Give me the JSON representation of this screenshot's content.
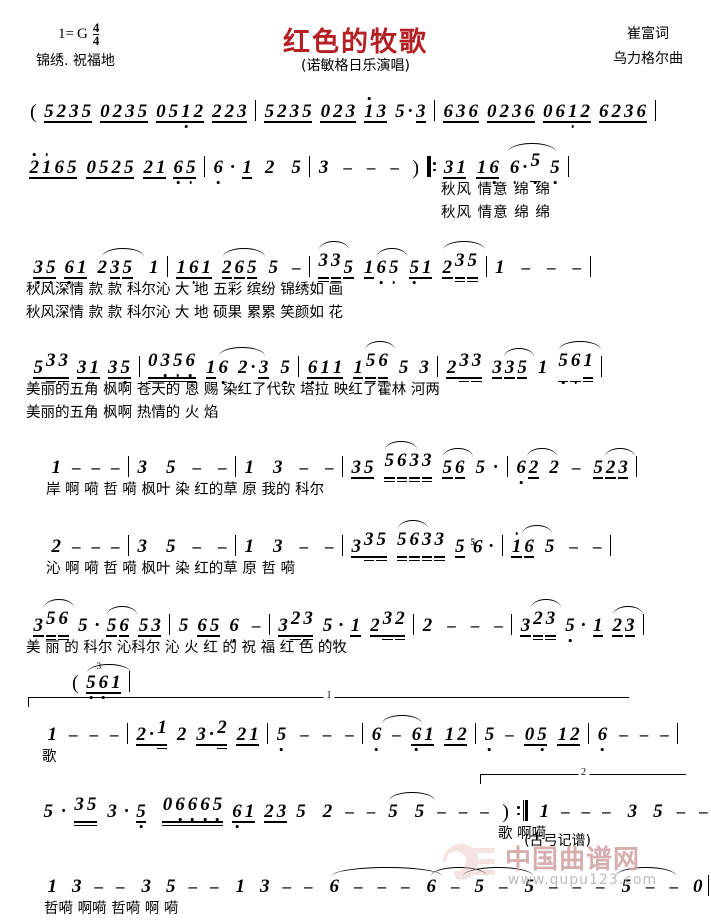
{
  "header": {
    "key_label": "1=",
    "key": "G",
    "time_num": "4",
    "time_den": "4",
    "subtitle_left": "锦绣. 祝福地",
    "title": "红色的牧歌",
    "singer": "(诺敏格日乐演唱)",
    "lyricist": "崔富词",
    "composer": "乌力格尔曲",
    "title_color": "#b52025"
  },
  "footer": {
    "transcriber": "(古弓记谱)",
    "watermark_site": "www.qupu123.com",
    "watermark_name": "中国曲谱网"
  },
  "systems": [
    {
      "id": "system-1",
      "measures": [
        {
          "notes": "5235 0235 0512 223"
        },
        {
          "notes": "5235 023 13 5·3"
        },
        {
          "notes": "636 0236 0612 6236"
        }
      ],
      "lyrics": []
    },
    {
      "id": "system-2",
      "measures": [
        {
          "notes": "21 65 05 25 21 65"
        },
        {
          "notes": "6 · 1 2 5"
        },
        {
          "notes": "3 - - -"
        },
        {
          "notes": "3 1 1 6 6·5 5"
        }
      ],
      "lyrics_1": "秋风 情意 绵  绵",
      "lyrics_2": "秋风 情意 绵  绵"
    },
    {
      "id": "system-3",
      "measures": [
        {
          "notes": "3 5 6 1 2 3 5 1"
        },
        {
          "notes": "1 6 1 2 6 5 5 -"
        },
        {
          "notes": "3 3 5 1 6 5 5 1 2 3 5"
        },
        {
          "notes": "1 - - -"
        }
      ],
      "lyrics_1": "秋风深情 款  款  科尔沁 大   地   五彩  缤纷  锦绣如     画",
      "lyrics_2": "秋风深情 款  款  科尔沁 大   地   硕果  累累  笑颜如     花"
    },
    {
      "id": "system-4",
      "measures": [
        {
          "notes": "5 3 3 3 1 3 5"
        },
        {
          "notes": "0 3 5 6 1 6 2 · 3 5"
        },
        {
          "notes": "6 1 1 1 5 6 5 3"
        },
        {
          "notes": "2 3 3 3 3 5 1 5 6 1"
        }
      ],
      "lyrics_1": "美丽的五角 枫啊    苍天的 恩       赐   染红了代钦  塔拉   映红了霍林  河两",
      "lyrics_2": "美丽的五角 枫啊    热情的 火       焰"
    },
    {
      "id": "system-5",
      "measures": [
        {
          "notes": "1 - - -"
        },
        {
          "notes": "3 5 - -"
        },
        {
          "notes": "1 3 - -"
        },
        {
          "notes": "3 5 5 6 3 3 5 6 5 ·"
        },
        {
          "notes": "6 2 2 - 5 2 3"
        }
      ],
      "lyrics_1": "岸    啊 嗬    哲 嗬    枫叶 染 红的草 原     我的     科尔"
    },
    {
      "id": "system-6",
      "measures": [
        {
          "notes": "2 - - -"
        },
        {
          "notes": "3 5 - -"
        },
        {
          "notes": "1 3 - -"
        },
        {
          "notes": "3 3 5 5 6 3 3 5 #56 ·"
        },
        {
          "notes": "1 6 5 - -"
        }
      ],
      "lyrics_1": "沁    啊 嗬    哲 嗬    枫叶 染  红的草 原    哲  嗬"
    },
    {
      "id": "system-7",
      "measures": [
        {
          "notes": "3 5 6 5 · 5 6 5 3"
        },
        {
          "notes": "5 6 5 6 -"
        },
        {
          "notes": "3 2 3 5 · 1 2 3 2"
        },
        {
          "notes": "2 - - -"
        },
        {
          "notes": "3 2 3 5 · 1 2 3"
        }
      ],
      "lyrics_1": "美 丽 的 科尔  沁科尔 沁    火  红 的 祝   福     红   色 的牧"
    },
    {
      "id": "system-8",
      "pickup": "( 5 6 1",
      "volta": "1",
      "measures": [
        {
          "notes": "1 - - -"
        },
        {
          "notes": "2·1 2 3·2 21"
        },
        {
          "notes": "5 - - -"
        },
        {
          "notes": "6 - 6 1 1 2"
        },
        {
          "notes": "5 - 0 5 1 2"
        },
        {
          "notes": "6 - - -"
        }
      ],
      "lyrics_1": "歌"
    },
    {
      "id": "system-9",
      "volta": "2",
      "measures": [
        {
          "notes": "5 · 3 5 3 · 5"
        },
        {
          "notes": "0 6 6 6 5 6 1 2 3 5"
        },
        {
          "notes": "2 - - 5"
        },
        {
          "notes": "5 - - - -"
        },
        {
          "notes": "1 - - -"
        },
        {
          "notes": "3 5 - -"
        }
      ],
      "lyrics_1": "歌    啊嗬"
    },
    {
      "id": "system-10",
      "measures": [
        {
          "notes": "1 3 - -"
        },
        {
          "notes": "3 5 - -"
        },
        {
          "notes": "1 3 - -"
        },
        {
          "notes": "6 - - - -"
        },
        {
          "notes": "6 - 5 -"
        },
        {
          "notes": "5 - - -"
        },
        {
          "notes": "5 - - 0"
        }
      ],
      "lyrics_1": "哲嗬   啊嗬   哲嗬   啊     嗬"
    }
  ]
}
